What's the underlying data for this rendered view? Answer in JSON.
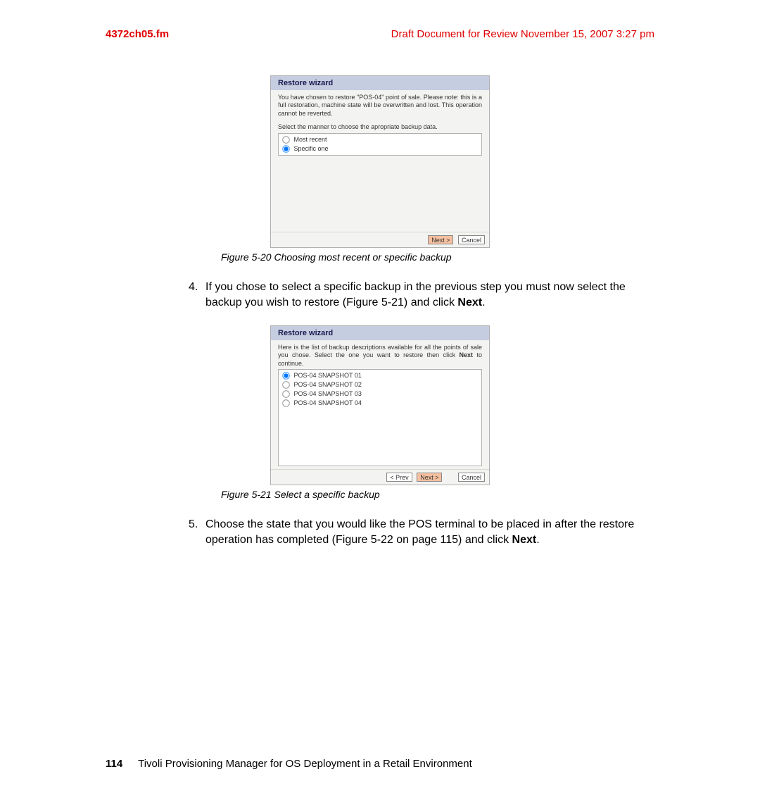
{
  "header": {
    "filename": "4372ch05.fm",
    "draft_line": "Draft Document for Review November 15, 2007 3:27 pm"
  },
  "wizard1": {
    "title": "Restore wizard",
    "p1": "You have chosen to restore \"POS-04\" point of sale. Please note: this is a full restoration, machine state will be overwritten and lost. This operation cannot be reverted.",
    "p2": "Select the manner to choose the apropriate backup data.",
    "options": [
      "Most recent",
      "Specific one"
    ],
    "next_label": "Next >",
    "cancel_label": "Cancel"
  },
  "caption1": "Figure 5-20   Choosing most recent or specific backup",
  "step4": {
    "num": "4.",
    "text_a": "If you chose to select a specific backup in the previous step you must now select the backup you wish to restore (Figure 5-21) and click ",
    "bold": "Next",
    "text_b": "."
  },
  "wizard2": {
    "title": "Restore wizard",
    "intro_a": "Here is the list of backup descriptions available for all the points of sale you chose. Select the one you want to restore then click ",
    "intro_bold": "Next",
    "intro_b": " to continue.",
    "items": [
      "POS-04 SNAPSHOT 01",
      "POS-04 SNAPSHOT 02",
      "POS-04 SNAPSHOT 03",
      "POS-04 SNAPSHOT 04"
    ],
    "prev_label": "< Prev",
    "next_label": "Next >",
    "cancel_label": "Cancel"
  },
  "caption2": "Figure 5-21   Select a specific backup",
  "step5": {
    "num": "5.",
    "text_a": "Choose the state that you would like the POS terminal to be placed in after the restore operation has completed (Figure 5-22 on page 115) and click ",
    "bold": "Next",
    "text_b": "."
  },
  "footer": {
    "page_num": "114",
    "book_title": "Tivoli Provisioning Manager for OS Deployment in a Retail Environment"
  }
}
